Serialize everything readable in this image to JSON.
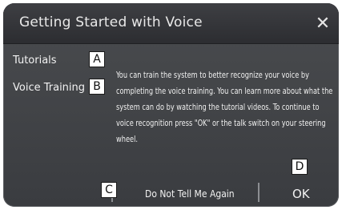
{
  "dialog": {
    "title": "Getting Started with Voice",
    "close_symbol": "✕"
  },
  "sidebar": {
    "items": [
      {
        "label": "Tutorials",
        "marker": "A"
      },
      {
        "label": "Voice Training",
        "marker": "B"
      }
    ]
  },
  "message": "You can train the system to better recognize your voice by completing the voice training. You can learn more about what the system can do by watching the tutorial videos. To continue to voice recognition press \"OK\" or the talk switch on your steering wheel.",
  "footer": {
    "dismiss_label": "Do Not Tell Me Again",
    "dismiss_marker": "C",
    "ok_label": "OK",
    "ok_marker": "D"
  },
  "colors": {
    "panel": "#3a3c40",
    "title_bar": "#2c2d31",
    "text": "#f0f0f0"
  }
}
